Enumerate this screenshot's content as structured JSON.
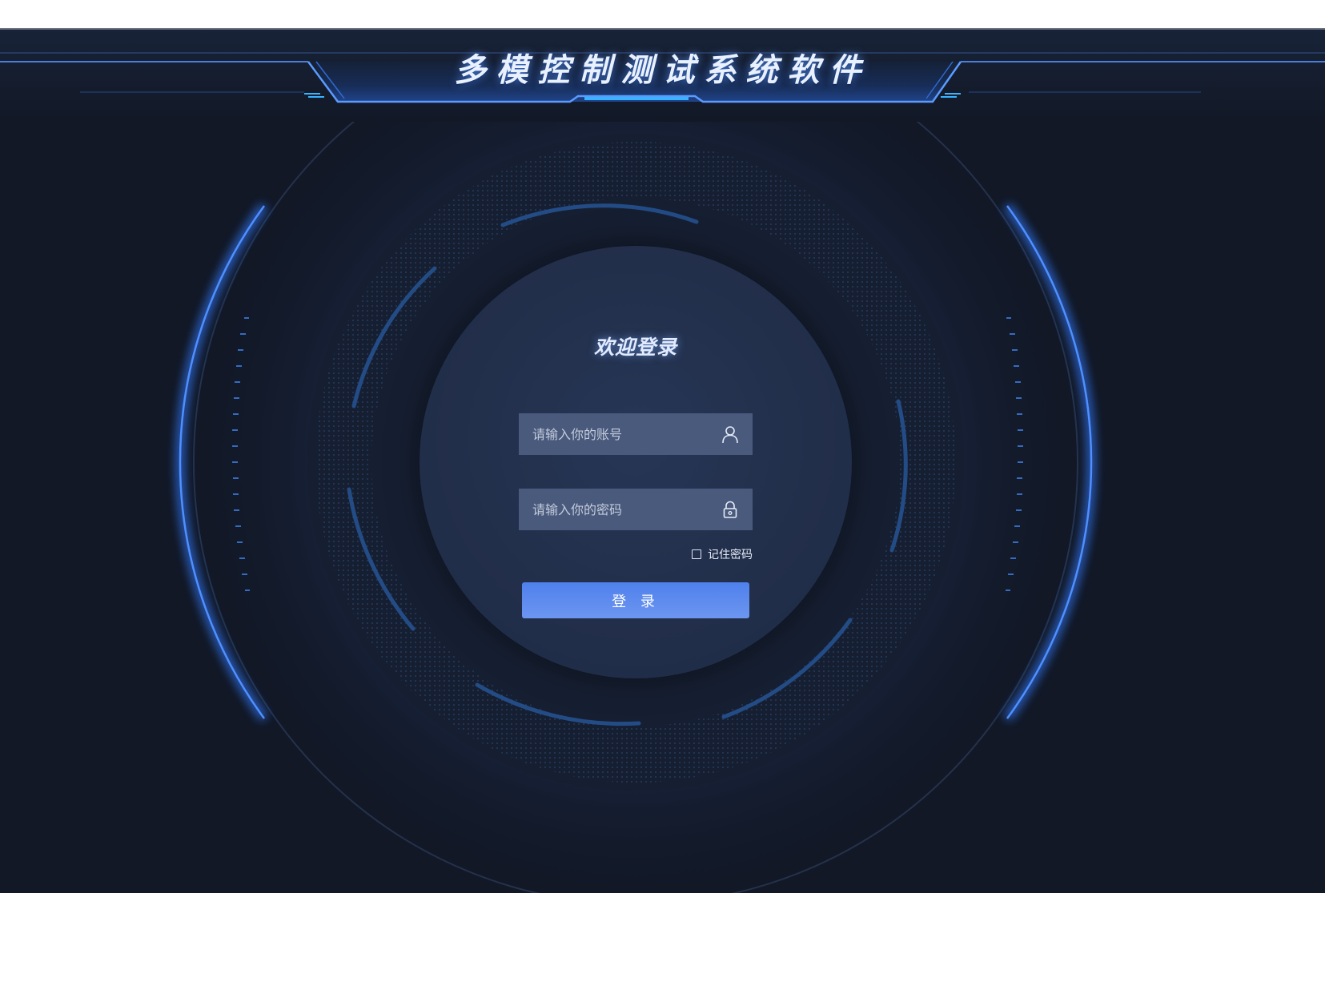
{
  "header": {
    "title": "多模控制测试系统软件"
  },
  "login": {
    "title": "欢迎登录",
    "username_placeholder": "请输入你的账号",
    "username_icon": "user-icon",
    "password_placeholder": "请输入你的密码",
    "password_icon": "lock-icon",
    "remember_label": "记住密码",
    "remember_checked": false,
    "submit_label": "登 录"
  },
  "colors": {
    "background": "#121826",
    "panel": "#222f4b",
    "input": "#4a5a7d",
    "accent": "#4f80ec",
    "glow": "#2f7bff"
  }
}
